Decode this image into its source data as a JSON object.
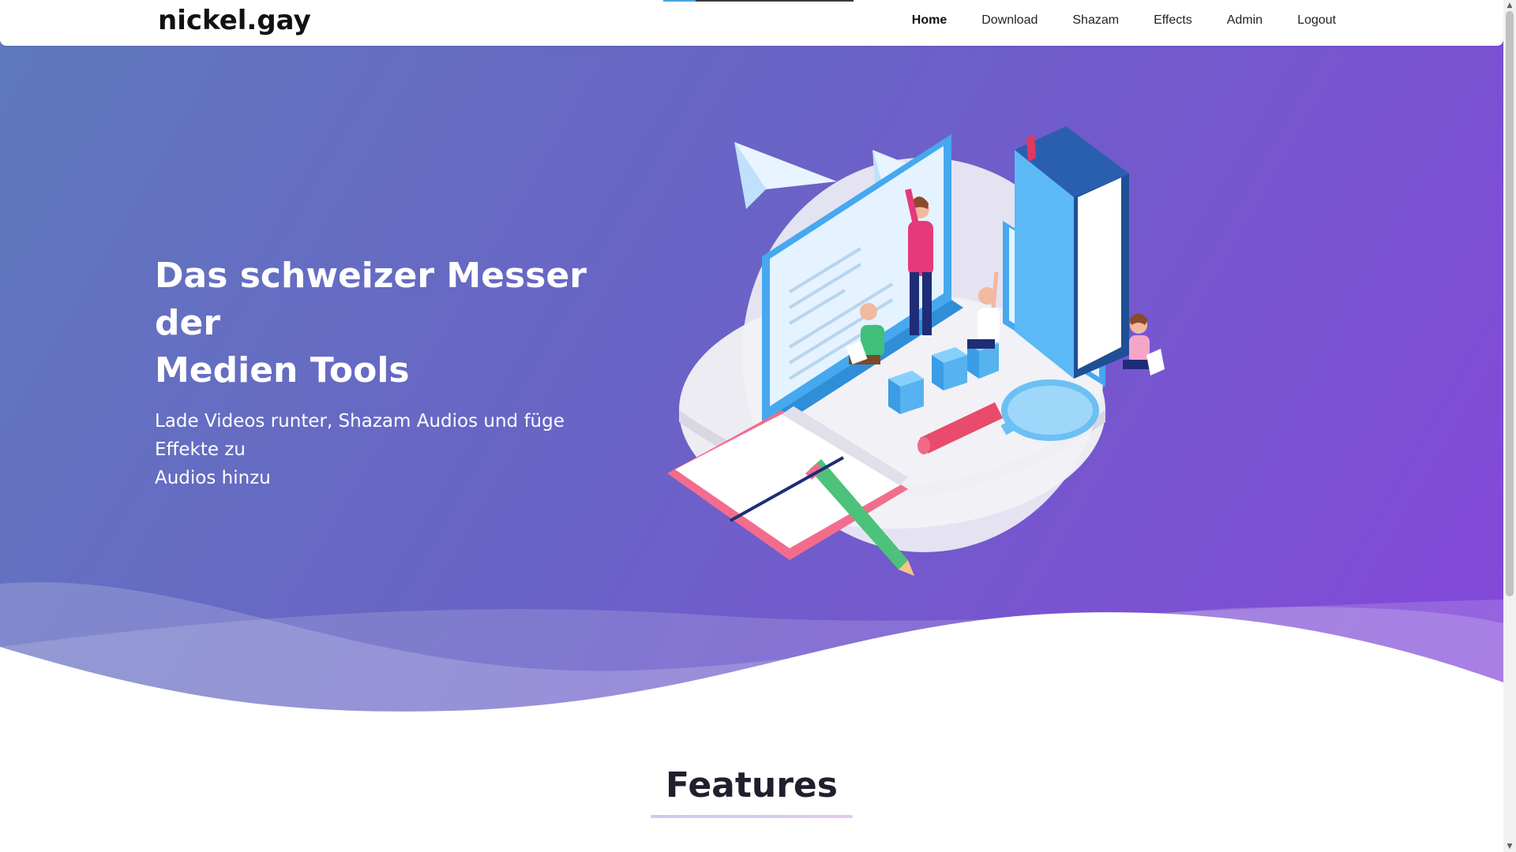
{
  "header": {
    "brand": "nickel.gay",
    "nav": [
      {
        "label": "Home",
        "active": true
      },
      {
        "label": "Download",
        "active": false
      },
      {
        "label": "Shazam",
        "active": false
      },
      {
        "label": "Effects",
        "active": false
      },
      {
        "label": "Admin",
        "active": false
      },
      {
        "label": "Logout",
        "active": false
      }
    ],
    "progress": 0.17
  },
  "hero": {
    "title_line1": "Das schweizer Messer der",
    "title_line2": "Medien Tools",
    "subtitle_line1": "Lade Videos runter, Shazam Audios und füge Effekte zu",
    "subtitle_line2": "Audios hinzu",
    "illustration": "isometric-people-working-illustration",
    "gradient": [
      "#5f79bd",
      "#6a63c6",
      "#8547da"
    ]
  },
  "features": {
    "title": "Features"
  },
  "scrollbar": {
    "up_icon": "▲",
    "down_icon": "▼"
  }
}
